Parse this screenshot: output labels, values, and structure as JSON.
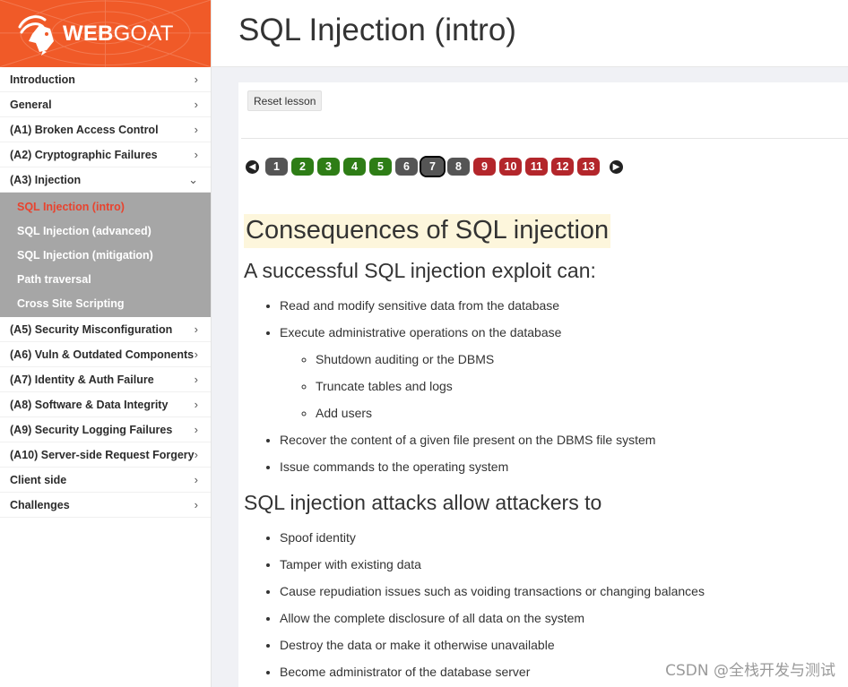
{
  "brand": {
    "name_bold": "WEB",
    "name_light": "GOAT"
  },
  "header": {
    "title": "SQL Injection (intro)"
  },
  "sidebar": {
    "items_top": [
      {
        "label": "Introduction",
        "chevron": "›"
      },
      {
        "label": "General",
        "chevron": "›"
      },
      {
        "label": "(A1) Broken Access Control",
        "chevron": "›"
      },
      {
        "label": "(A2) Cryptographic Failures",
        "chevron": "›"
      },
      {
        "label": "(A3) Injection",
        "chevron": "⌄"
      }
    ],
    "subitems": [
      {
        "label": "SQL Injection (intro)",
        "active": true
      },
      {
        "label": "SQL Injection (advanced)",
        "active": false
      },
      {
        "label": "SQL Injection (mitigation)",
        "active": false
      },
      {
        "label": "Path traversal",
        "active": false
      },
      {
        "label": "Cross Site Scripting",
        "active": false
      }
    ],
    "items_bottom": [
      {
        "label": "(A5) Security Misconfiguration",
        "chevron": "›"
      },
      {
        "label": "(A6) Vuln & Outdated Components",
        "chevron": "›"
      },
      {
        "label": "(A7) Identity & Auth Failure",
        "chevron": "›"
      },
      {
        "label": "(A8) Software & Data Integrity",
        "chevron": "›"
      },
      {
        "label": "(A9) Security Logging Failures",
        "chevron": "›"
      },
      {
        "label": "(A10) Server-side Request Forgery",
        "chevron": "›"
      },
      {
        "label": "Client side",
        "chevron": "›"
      },
      {
        "label": "Challenges",
        "chevron": "›"
      }
    ]
  },
  "toolbar": {
    "reset_label": "Reset lesson"
  },
  "pager": {
    "prev_icon": "arrow-left-icon",
    "next_icon": "arrow-right-icon",
    "pages": [
      {
        "label": "1",
        "color": "#555555",
        "current": false
      },
      {
        "label": "2",
        "color": "#2e7d16",
        "current": false
      },
      {
        "label": "3",
        "color": "#2e7d16",
        "current": false
      },
      {
        "label": "4",
        "color": "#2e7d16",
        "current": false
      },
      {
        "label": "5",
        "color": "#2e7d16",
        "current": false
      },
      {
        "label": "6",
        "color": "#555555",
        "current": false
      },
      {
        "label": "7",
        "color": "#555555",
        "current": true
      },
      {
        "label": "8",
        "color": "#555555",
        "current": false
      },
      {
        "label": "9",
        "color": "#b3262b",
        "current": false
      },
      {
        "label": "10",
        "color": "#b3262b",
        "current": false
      },
      {
        "label": "11",
        "color": "#b3262b",
        "current": false
      },
      {
        "label": "12",
        "color": "#b3262b",
        "current": false
      },
      {
        "label": "13",
        "color": "#b3262b",
        "current": false
      }
    ]
  },
  "lesson": {
    "heading": "Consequences of SQL injection",
    "section1": {
      "title": "A successful SQL injection exploit can:",
      "items": [
        {
          "text": "Read and modify sensitive data from the database"
        },
        {
          "text": "Execute administrative operations on the database",
          "children": [
            "Shutdown auditing or the DBMS",
            "Truncate tables and logs",
            "Add users"
          ]
        },
        {
          "text": "Recover the content of a given file present on the DBMS file system"
        },
        {
          "text": "Issue commands to the operating system"
        }
      ]
    },
    "section2": {
      "title": "SQL injection attacks allow attackers to",
      "items": [
        "Spoof identity",
        "Tamper with existing data",
        "Cause repudiation issues such as voiding transactions or changing balances",
        "Allow the complete disclosure of all data on the system",
        "Destroy the data or make it otherwise unavailable",
        "Become administrator of the database server"
      ]
    }
  },
  "watermark": "CSDN @全栈开发与测试",
  "colors": {
    "brand": "#f05a28",
    "active_link": "#e8432e",
    "submenu_bg": "#a6a6a6"
  }
}
